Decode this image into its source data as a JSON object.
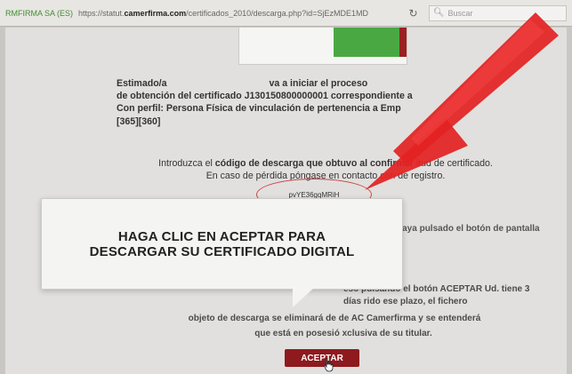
{
  "browser": {
    "cert_id": "RMFIRMA SA (ES)",
    "url_prefix": "https://statut.",
    "url_host": "camerfirma.com",
    "url_path": "/certificados_2010/descarga.php?id=SjEzMDE1MD",
    "search_placeholder": "Buscar"
  },
  "page": {
    "para1_line1": "Estimado/a",
    "para1_line1b": "va a iniciar el proceso",
    "para1_line2": "de obtención del certificado J130150800000001 correspondiente a",
    "para1_line3": "Con perfil: Persona Física de vinculación de pertenencia a Emp",
    "para1_line4": "[365][360]",
    "para2_prefix": "Introduzca el",
    "para2_bold": "código de descarga que obtuvo al confirmar",
    "para2_suffix": "itud de certificado.",
    "para2_line2": "En caso de pérdida póngase en contacto con",
    "para2_line2b": "de registro.",
    "code_value": "pvYE36gqMRiH",
    "bg_text_1": "una vez que haya pulsado el botón de pantalla de descarga.",
    "bg_text_2": "eso pulsando el botón ACEPTAR Ud. tiene 3 días rido ese plazo, el fichero",
    "bg_text_3": "objeto de descarga se eliminará de",
    "bg_text_3b": "de AC Camerfirma y se entenderá",
    "bg_text_4": "que está en posesió",
    "bg_text_4b": "xclusiva de su titular."
  },
  "callout": {
    "line1": "HAGA CLIC EN ACEPTAR PARA",
    "line2": "DESCARGAR SU CERTIFICADO DIGITAL"
  },
  "accept_button": "ACEPTAR",
  "colors": {
    "arrow": "#e32222",
    "button": "#8e1a1e",
    "green_block": "#4aa843"
  }
}
